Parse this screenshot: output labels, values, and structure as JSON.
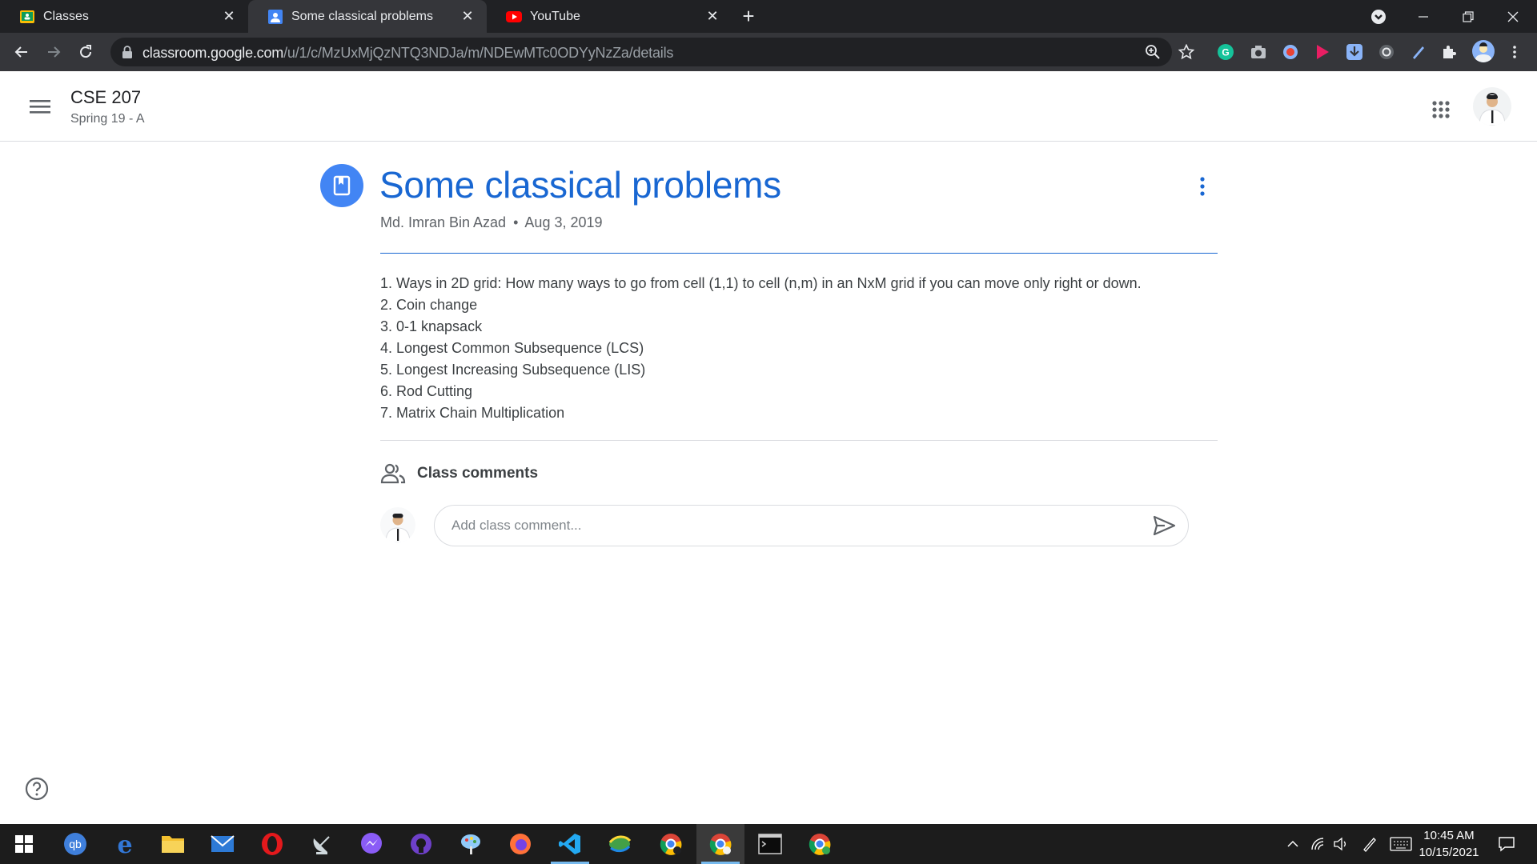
{
  "browser": {
    "tabs": [
      {
        "title": "Classes",
        "active": false
      },
      {
        "title": "Some classical problems",
        "active": true
      },
      {
        "title": "YouTube",
        "active": false
      }
    ],
    "url_host": "classroom.google.com",
    "url_path": "/u/1/c/MzUxMjQzNTQ3NDJa/m/NDEwMTc0ODYyNzZa/details"
  },
  "classroom": {
    "class_name": "CSE 207",
    "class_section": "Spring 19 - A"
  },
  "post": {
    "title": "Some classical problems",
    "author": "Md. Imran Bin Azad",
    "separator": "•",
    "date": "Aug 3, 2019",
    "items": [
      "1. Ways in 2D grid: How many ways to go from cell (1,1) to cell (n,m) in an NxM grid if you can move only right or down.",
      "2. Coin change",
      "3. 0-1 knapsack",
      "4. Longest Common Subsequence (LCS)",
      "5. Longest Increasing Subsequence (LIS)",
      "6. Rod Cutting",
      "7. Matrix Chain Multiplication"
    ]
  },
  "comments": {
    "heading": "Class comments",
    "placeholder": "Add class comment..."
  },
  "taskbar": {
    "time": "10:45 AM",
    "date": "10/15/2021"
  },
  "colors": {
    "accent_blue": "#1967d2",
    "icon_blue": "#4285f4",
    "chrome_dark": "#202124",
    "chrome_mid": "#35363a",
    "taskbar": "#1c1c1c"
  }
}
